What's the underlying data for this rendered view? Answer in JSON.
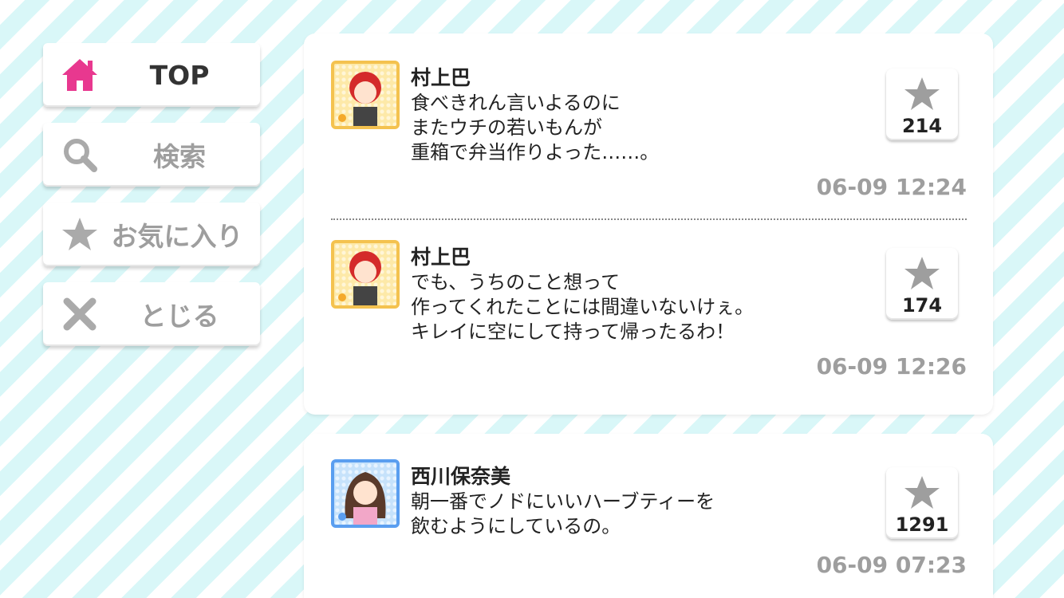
{
  "nav": {
    "top": "TOP",
    "search": "検索",
    "favorites": "お気に入り",
    "close": "とじる"
  },
  "colors": {
    "accent": "#e8388f",
    "inactive": "#9e9e9e",
    "stripe": "#d9f7f8"
  },
  "posts": [
    {
      "name": "村上巴",
      "text": "食べきれん言いよるのに\nまたウチの若いもんが\n重箱で弁当作りよった……。",
      "favorites": "214",
      "time": "06-09 12:24"
    },
    {
      "name": "村上巴",
      "text": "でも、うちのこと想って\n作ってくれたことには間違いないけぇ。\nキレイに空にして持って帰ったるわ！",
      "favorites": "174",
      "time": "06-09 12:26"
    },
    {
      "name": "西川保奈美",
      "text": "朝一番でノドにいいハーブティーを\n飲むようにしているの。",
      "favorites": "1291",
      "time": "06-09 07:23"
    }
  ]
}
